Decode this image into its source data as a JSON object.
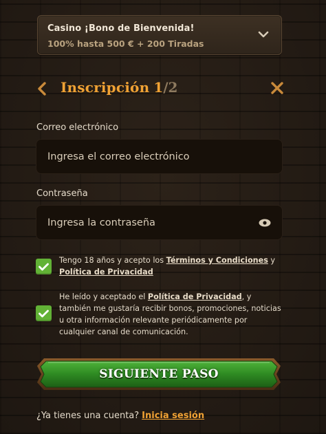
{
  "bonus": {
    "title": "Casino ¡Bono de Bienvenida!",
    "subtitle": "100% hasta 500 € + 200 Tiradas",
    "expand_icon": "chevron-down-icon"
  },
  "header": {
    "title": "Inscripción",
    "step_current": "1",
    "step_separator": "/",
    "step_total": "2",
    "back_icon": "chevron-left-icon",
    "close_icon": "close-icon"
  },
  "form": {
    "email_label": "Correo electrónico",
    "email_placeholder": "Ingresa el correo electrónico",
    "email_value": "",
    "password_label": "Contraseña",
    "password_placeholder": "Ingresa la contraseña",
    "password_value": "",
    "password_toggle_icon": "eye-icon"
  },
  "consents": [
    {
      "checked": true,
      "text_before": "Tengo 18 años y acepto los ",
      "link1": "Términos y Condiciones",
      "text_middle": " y",
      "link2": "Política de Privacidad"
    },
    {
      "checked": true,
      "text_before": "He leído y aceptado el ",
      "link": "Política de Privacidad",
      "text_after": ", y también me gustaría recibir bonos, promociones, noticias u otra información relevante periódicamente por cualquier canal de comunicación."
    }
  ],
  "cta": {
    "label": "SIGUIENTE PASO"
  },
  "footer": {
    "question": "¿Ya tienes una cuenta?",
    "login_link": "Inicia sesión"
  },
  "colors": {
    "accent": "#f0a234",
    "checkbox": "#62b236",
    "cta_green": "#2f8a22",
    "background": "#241c14"
  }
}
